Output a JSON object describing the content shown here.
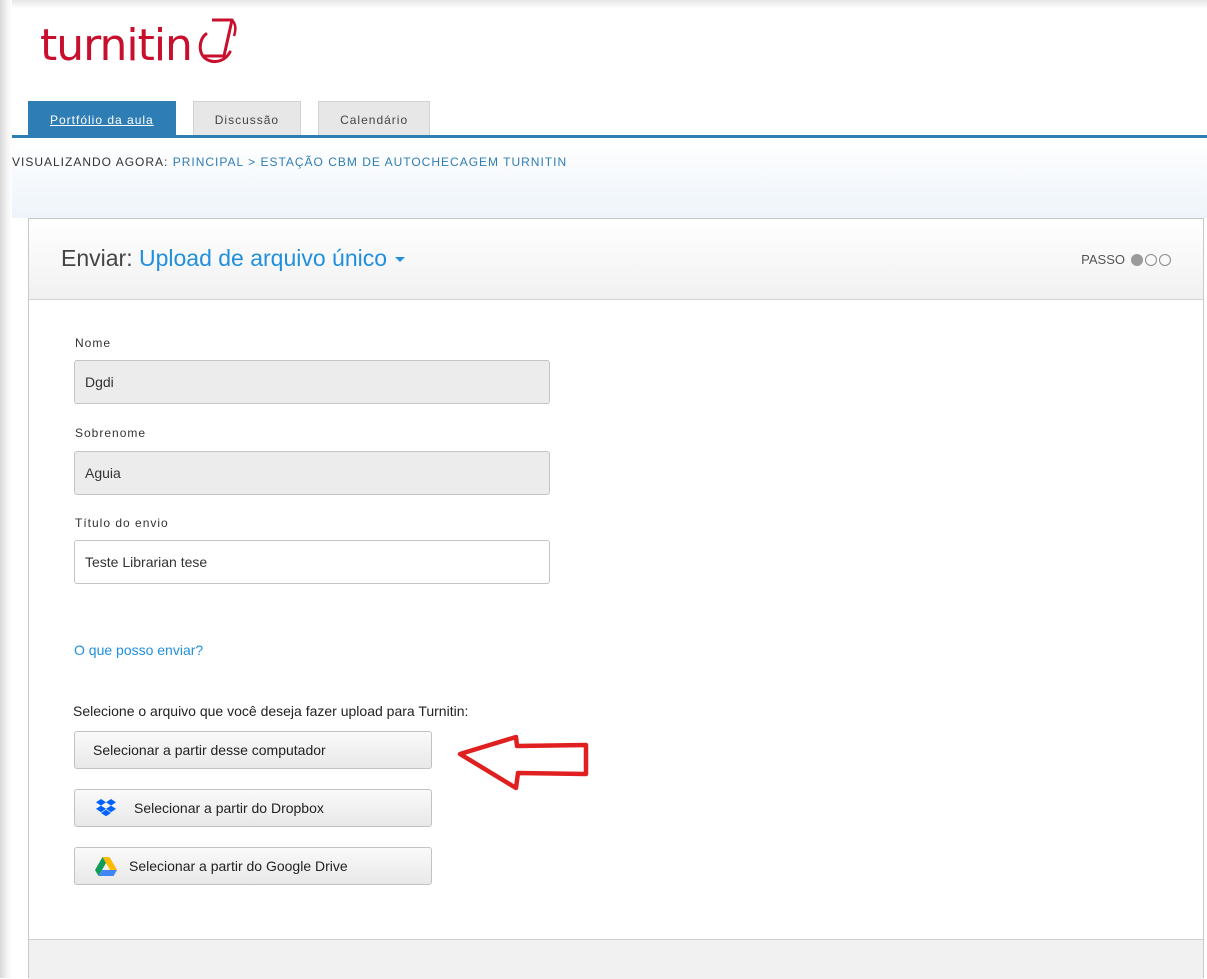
{
  "brand": {
    "logo_text": "turnitin",
    "logo_color": "#c8102e"
  },
  "tabs": [
    {
      "label": "Portfólio da aula",
      "active": true
    },
    {
      "label": "Discussão",
      "active": false
    },
    {
      "label": "Calendário",
      "active": false
    }
  ],
  "breadcrumb": {
    "prefix": "VISUALIZANDO AGORA:",
    "home": "PRINCIPAL",
    "separator": ">",
    "current": "ESTAÇÃO CBM DE AUTOCHECAGEM TURNITIN"
  },
  "submit": {
    "title_prefix": "Enviar:",
    "mode_label": "Upload de arquivo único",
    "step_label": "PASSO",
    "steps_total": 3,
    "step_current": 1
  },
  "form": {
    "first_name_label": "Nome",
    "first_name_value": "Dgdi",
    "last_name_label": "Sobrenome",
    "last_name_value": "Aguia",
    "title_label": "Título do envio",
    "title_value": "Teste Librarian tese",
    "help_link": "O que posso enviar?",
    "file_prompt": "Selecione o arquivo que você deseja fazer upload para Turnitin:"
  },
  "upload_buttons": {
    "computer": "Selecionar a partir desse computador",
    "dropbox": "Selecionar a partir do Dropbox",
    "gdrive": "Selecionar a partir do Google Drive"
  },
  "colors": {
    "accent": "#2f7db5",
    "link": "#1f8fde",
    "annotation_arrow": "#e02020"
  }
}
